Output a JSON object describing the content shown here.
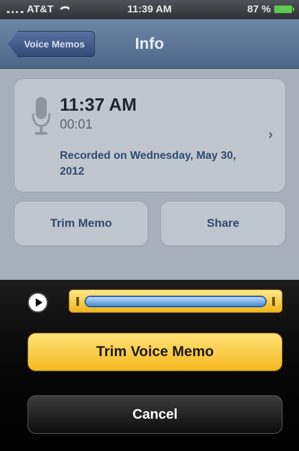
{
  "status_bar": {
    "carrier": "AT&T",
    "time": "11:39 AM",
    "battery": "87 %",
    "icons": [
      "signal-icon",
      "wifi-icon",
      "battery-icon"
    ]
  },
  "nav": {
    "back_label": "Voice Memos",
    "title": "Info"
  },
  "memo": {
    "time": "11:37 AM",
    "duration": "00:01",
    "recorded_on": "Recorded on Wednesday, May 30, 2012",
    "icons": [
      "microphone-icon",
      "chevron-right-icon"
    ]
  },
  "actions": {
    "trim_label": "Trim Memo",
    "share_label": "Share"
  },
  "trim_panel": {
    "selection_fraction": 1.0,
    "confirm_label": "Trim Voice Memo",
    "cancel_label": "Cancel",
    "icons": [
      "play-icon"
    ]
  },
  "colors": {
    "accent_yellow": "#f5b91e",
    "nav_blue": "#4d6587",
    "link_blue": "#2e4a70"
  }
}
